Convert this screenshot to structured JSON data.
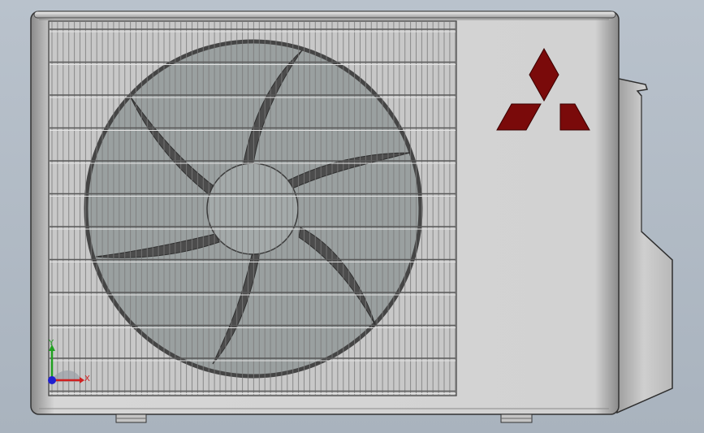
{
  "viewport": {
    "background_top": "#b9c2cc",
    "background_bottom": "#a9b3be"
  },
  "model": {
    "name": "outdoor-ac-unit",
    "body_color": "#cfcfcf",
    "grille_color": "#6e6e6e",
    "fan_color": "#8f9696",
    "logo_color": "#7a0a0a"
  },
  "triad": {
    "x_label": "X",
    "y_label": "Y",
    "x_color": "#d02020",
    "y_color": "#20a020",
    "z_color": "#2020d0"
  }
}
